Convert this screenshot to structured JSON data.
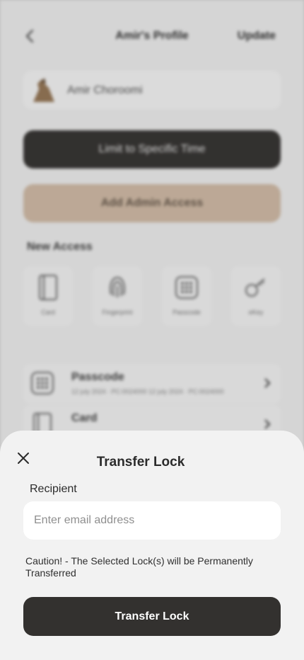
{
  "background": {
    "header": {
      "title": "Amir's Profile",
      "update_label": "Update"
    },
    "profile": {
      "name": "Amir Choroomi"
    },
    "limit_button_label": "Limit to Specific Time",
    "admin_button_label": "Add Admin Access",
    "new_access": {
      "title": "New Access",
      "items": [
        {
          "label": "Card",
          "icon": "card-icon"
        },
        {
          "label": "Fingerprint",
          "icon": "fingerprint-icon"
        },
        {
          "label": "Passcode",
          "icon": "passcode-icon"
        },
        {
          "label": "eKey",
          "icon": "ekey-icon"
        }
      ]
    },
    "access_list": [
      {
        "title": "Passcode",
        "subtitle": "12 july 2024 · PC:0024000 12 july 2024 · PC:0024000",
        "icon": "passcode-icon"
      },
      {
        "title": "Card",
        "subtitle": "",
        "icon": "card-icon"
      }
    ]
  },
  "sheet": {
    "title": "Transfer Lock",
    "recipient_label": "Recipient",
    "email_placeholder": "Enter email address",
    "email_value": "",
    "caution": "Caution! - The Selected Lock(s) will be Permanently Transferred",
    "submit_label": "Transfer Lock"
  },
  "colors": {
    "dark_button": "#33312f",
    "accent_tan": "#d6c0ab",
    "sheet_bg": "#f2f2f2"
  }
}
